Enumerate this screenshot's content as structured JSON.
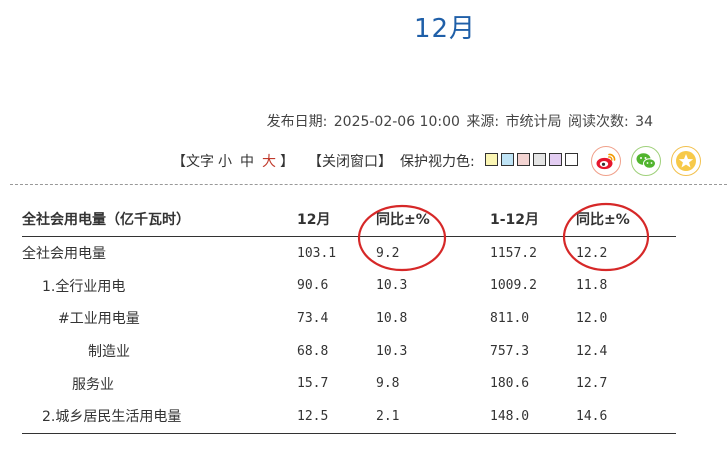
{
  "page": {
    "title": "12月"
  },
  "meta": {
    "publish_label": "发布日期:",
    "publish_date": "2025-02-06 10:00",
    "source_label": "来源:",
    "source": "市统计局",
    "reads_label": "阅读次数:",
    "reads": "34"
  },
  "toolbar": {
    "text_size_open": "【文字",
    "size_small": "小",
    "size_medium": "中",
    "size_large": "大",
    "text_size_close": "】",
    "close_window": "【关闭窗口】",
    "eye_protect_label": "保护视力色:",
    "swatches": [
      "#fbf6b4",
      "#bfe4f6",
      "#f3d4d2",
      "#e4e4e4",
      "#e3cdf2",
      "#ffffff"
    ]
  },
  "table": {
    "headers": [
      "全社会用电量（亿千瓦时）",
      "12月",
      "同比±%",
      "1-12月",
      "同比±%"
    ],
    "rows": [
      {
        "label": "全社会用电量",
        "values": [
          "103.1",
          "9.2",
          "1157.2",
          "12.2"
        ]
      },
      {
        "label": "1.全行业用电",
        "values": [
          "90.6",
          "10.3",
          "1009.2",
          "11.8"
        ]
      },
      {
        "label": "#工业用电量",
        "values": [
          "73.4",
          "10.8",
          "811.0",
          "12.0"
        ]
      },
      {
        "label": "制造业",
        "values": [
          "68.8",
          "10.3",
          "757.3",
          "12.4"
        ]
      },
      {
        "label": "服务业",
        "values": [
          "15.7",
          "9.8",
          "180.6",
          "12.7"
        ]
      },
      {
        "label": "2.城乡居民生活用电量",
        "values": [
          "12.5",
          "2.1",
          "148.0",
          "14.6"
        ]
      }
    ]
  },
  "colors": {
    "title": "#1f5fa8",
    "annotation": "#d62828",
    "active_size": "#c0392b"
  },
  "icons": [
    "weibo-icon",
    "wechat-icon",
    "star-icon"
  ]
}
